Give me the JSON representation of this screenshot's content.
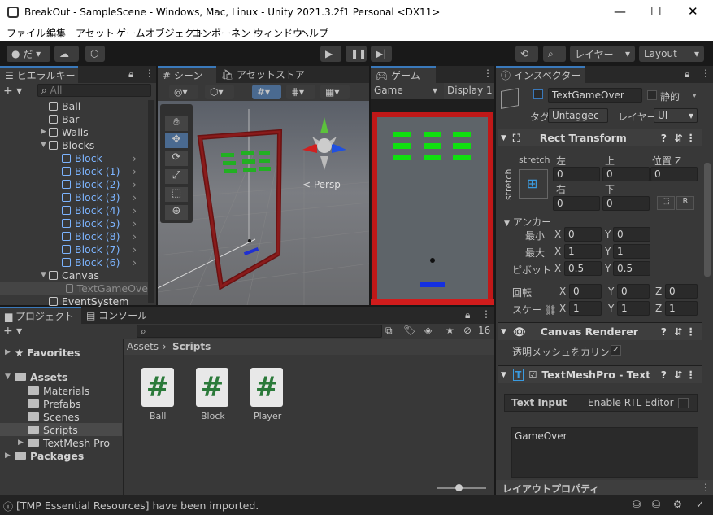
{
  "window": {
    "title": "BreakOut - SampleScene - Windows, Mac, Linux - Unity 2021.3.2f1 Personal <DX11>",
    "min": "—",
    "max": "☐",
    "close": "✕"
  },
  "menu": [
    "ファイル",
    "編集",
    "アセット",
    "ゲームオブジェクト",
    "コンポーネント",
    "ウィンドウ",
    "ヘルプ"
  ],
  "toolbar": {
    "account": "だ",
    "layers": "レイヤー",
    "layout": "Layout"
  },
  "hierarchy": {
    "tab": "ヒエラルキー",
    "search_placeholder": "All",
    "items": [
      {
        "label": "Ball",
        "indent": 0,
        "color": "normal"
      },
      {
        "label": "Bar",
        "indent": 0,
        "color": "normal"
      },
      {
        "label": "Walls",
        "indent": 0,
        "color": "normal",
        "arrow": "▶"
      },
      {
        "label": "Blocks",
        "indent": 0,
        "color": "normal",
        "arrow": "▼"
      },
      {
        "label": "Block",
        "indent": 1,
        "color": "blue"
      },
      {
        "label": "Block (1)",
        "indent": 1,
        "color": "blue"
      },
      {
        "label": "Block (2)",
        "indent": 1,
        "color": "blue"
      },
      {
        "label": "Block (3)",
        "indent": 1,
        "color": "blue"
      },
      {
        "label": "Block (4)",
        "indent": 1,
        "color": "blue"
      },
      {
        "label": "Block (5)",
        "indent": 1,
        "color": "blue"
      },
      {
        "label": "Block (8)",
        "indent": 1,
        "color": "blue"
      },
      {
        "label": "Block (7)",
        "indent": 1,
        "color": "blue"
      },
      {
        "label": "Block (6)",
        "indent": 1,
        "color": "blue"
      },
      {
        "label": "Canvas",
        "indent": 0,
        "color": "normal",
        "arrow": "▼"
      },
      {
        "label": "TextGameOve",
        "indent": 1,
        "color": "dim"
      },
      {
        "label": "EventSystem",
        "indent": 0,
        "color": "normal"
      }
    ]
  },
  "scene": {
    "tab": "シーン",
    "tab2": "アセットストア",
    "persp": "< Persp"
  },
  "game": {
    "tab": "ゲーム",
    "display": "Game",
    "display2": "Display 1"
  },
  "inspector": {
    "tab": "インスペクター",
    "name": "TextGameOver",
    "static": "静的",
    "tag_label": "タグ",
    "tag": "Untaggec",
    "layer_label": "レイヤー",
    "layer": "UI",
    "rect": {
      "title": "Rect Transform",
      "stretch_h": "stretch",
      "stretch_v": "stretch",
      "left": "左",
      "top": "上",
      "posz": "位置 Z",
      "right": "右",
      "bottom": "下",
      "v_left": "0",
      "v_top": "0",
      "v_posz": "0",
      "v_right": "0",
      "v_bottom": "0",
      "r": "R",
      "anchor": "アンカー",
      "min": "最小",
      "max": "最大",
      "pivot": "ピボット",
      "rot": "回転",
      "scale": "スケー",
      "min_x": "0",
      "min_y": "0",
      "max_x": "1",
      "max_y": "1",
      "pivot_x": "0.5",
      "pivot_y": "0.5",
      "rot_x": "0",
      "rot_y": "0",
      "rot_z": "0",
      "sc_x": "1",
      "sc_y": "1",
      "sc_z": "1"
    },
    "canvas_renderer": {
      "title": "Canvas Renderer",
      "cull": "透明メッシュをカリング"
    },
    "tmp": {
      "title": "TextMeshPro - Text",
      "input": "Text Input",
      "rtl": "Enable RTL Editor",
      "text": "GameOver"
    },
    "layout": "レイアウトプロパティ"
  },
  "project": {
    "tab": "プロジェクト",
    "tab2": "コンソール",
    "count": "16",
    "tree": [
      {
        "label": "Favorites",
        "bold": true,
        "indent": 0,
        "arrow": "▶"
      },
      {
        "label": "Assets",
        "bold": true,
        "indent": 0,
        "arrow": "▼"
      },
      {
        "label": "Materials",
        "indent": 1
      },
      {
        "label": "Prefabs",
        "indent": 1
      },
      {
        "label": "Scenes",
        "indent": 1
      },
      {
        "label": "Scripts",
        "indent": 1,
        "selected": true
      },
      {
        "label": "TextMesh Pro",
        "indent": 1,
        "arrow": "▶"
      },
      {
        "label": "Packages",
        "bold": true,
        "indent": 0,
        "arrow": "▶"
      }
    ],
    "crumb1": "Assets",
    "crumb2": "Scripts",
    "assets": [
      "Ball",
      "Block",
      "Player"
    ]
  },
  "status": "[TMP Essential Resources] have been imported."
}
